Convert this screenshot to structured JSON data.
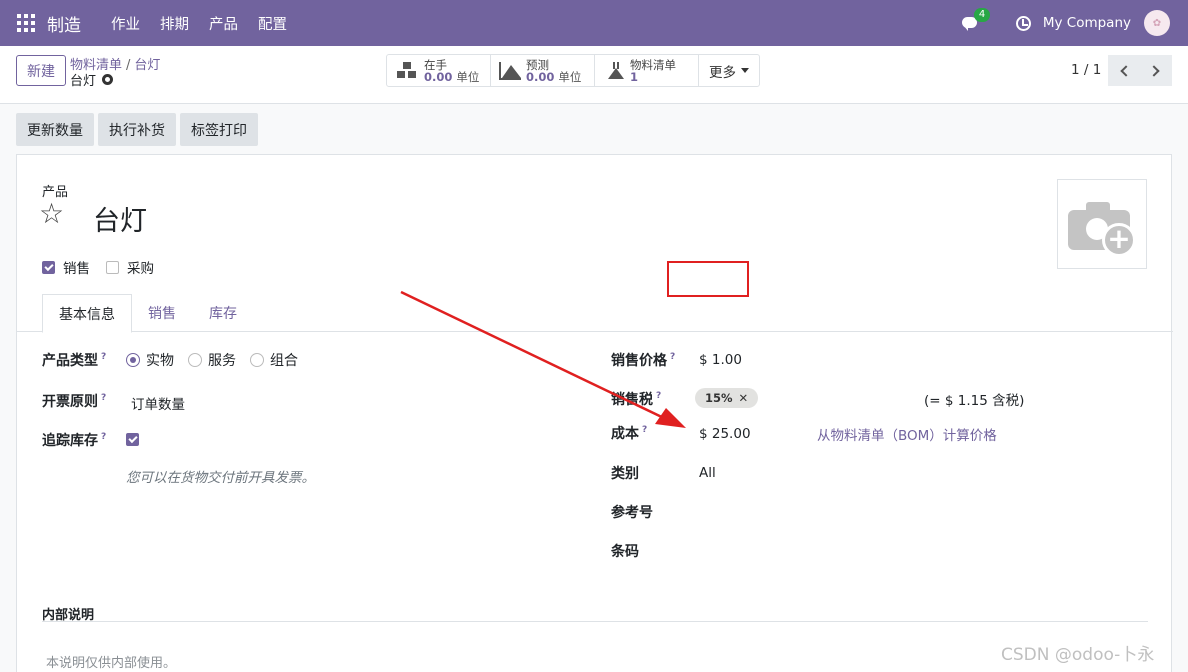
{
  "navbar": {
    "brand": "制造",
    "menu": [
      "作业",
      "排期",
      "产品",
      "配置"
    ],
    "chat_badge": "4",
    "company": "My Company",
    "colors": {
      "primary": "#71639e"
    }
  },
  "control": {
    "new_label": "新建",
    "breadcrumb_parent": "物料清单",
    "breadcrumb_current": "台灯",
    "record_title": "台灯",
    "smart_buttons": {
      "onhand_label": "在手",
      "onhand_value": "0.00",
      "onhand_unit": "单位",
      "forecast_label": "预测",
      "forecast_value": "0.00",
      "forecast_unit": "单位",
      "bom_label": "物料清单",
      "bom_value": "1"
    },
    "more_label": "更多",
    "pager": "1 / 1"
  },
  "actions": [
    "更新数量",
    "执行补货",
    "标签打印"
  ],
  "form": {
    "product_label": "产品",
    "product_name": "台灯",
    "sale_label": "销售",
    "purchase_label": "采购",
    "tabs": [
      "基本信息",
      "销售",
      "库存"
    ],
    "type_label": "产品类型",
    "type_options": [
      "实物",
      "服务",
      "组合"
    ],
    "invoice_label": "开票原则",
    "invoice_value": "订单数量",
    "track_label": "追踪库存",
    "hint": "您可以在货物交付前开具发票。",
    "price_label": "销售价格",
    "price_value": "$ 1.00",
    "tax_label": "销售税",
    "tax_tag": "15%",
    "tax_incl": "(= $ 1.15 含税)",
    "cost_label": "成本",
    "cost_value": "$ 25.00",
    "bom_link": "从物料清单（BOM）计算价格",
    "category_label": "类别",
    "category_value": "All",
    "ref_label": "参考号",
    "barcode_label": "条码",
    "notes_title": "内部说明",
    "notes_placeholder": "本说明仅供内部使用。",
    "help_mark": "?"
  },
  "watermark": "CSDN @odoo-卜永"
}
